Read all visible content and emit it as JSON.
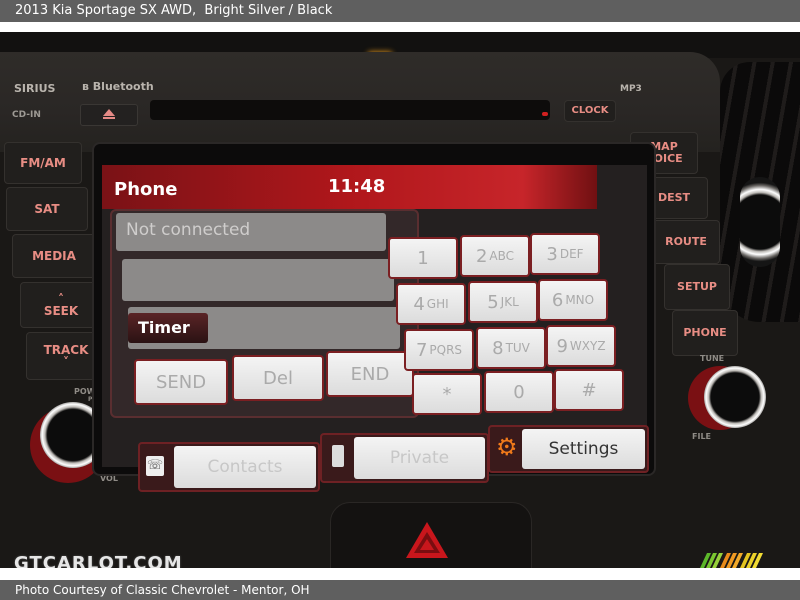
{
  "page": {
    "title": "2013 Kia Sportage SX AWD,  Bright Silver / Black",
    "footer": "Photo Courtesy of Classic Chevrolet - Mentor, OH",
    "watermark": "GTCARLOT.COM"
  },
  "head_unit": {
    "brands": {
      "sirius": "SIRIUS",
      "bluetooth": "Bluetooth",
      "mp3": "MP3"
    },
    "cd_in_label": "CD-IN",
    "clock_button": "CLOCK",
    "left_buttons": [
      "FM/AM",
      "SAT",
      "MEDIA",
      "SEEK",
      "TRACK"
    ],
    "right_buttons": [
      "MAP VOICE",
      "DEST",
      "ROUTE",
      "SETUP",
      "PHONE"
    ],
    "knob_labels": {
      "power": "POWER",
      "push": "PUSH",
      "vol": "VOL",
      "tune": "TUNE",
      "file": "FILE"
    }
  },
  "screen": {
    "title": "Phone",
    "time": "11:48",
    "status_field": "Not connected",
    "number_field": "",
    "timer_label": "Timer",
    "actions": [
      "SEND",
      "Del",
      "END"
    ],
    "keypad": [
      {
        "digit": "1",
        "letters": ""
      },
      {
        "digit": "2",
        "letters": "ABC"
      },
      {
        "digit": "3",
        "letters": "DEF"
      },
      {
        "digit": "4",
        "letters": "GHI"
      },
      {
        "digit": "5",
        "letters": "JKL"
      },
      {
        "digit": "6",
        "letters": "MNO"
      },
      {
        "digit": "7",
        "letters": "PQRS"
      },
      {
        "digit": "8",
        "letters": "TUV"
      },
      {
        "digit": "9",
        "letters": "WXYZ"
      },
      {
        "digit": "*",
        "letters": ""
      },
      {
        "digit": "0",
        "letters": ""
      },
      {
        "digit": "#",
        "letters": ""
      }
    ],
    "bottom_buttons": [
      {
        "label": "Contacts",
        "icon": "phonebook-icon"
      },
      {
        "label": "Private",
        "icon": "mobile-phone-icon"
      },
      {
        "label": "Settings",
        "icon": "gear-icon"
      }
    ]
  },
  "colors": {
    "accent_red": "#b0171b",
    "button_text": "#e88d84",
    "gear_orange": "#f07a1a"
  }
}
